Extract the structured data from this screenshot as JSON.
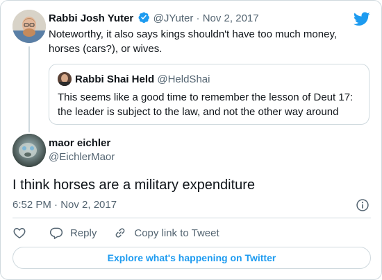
{
  "parent_tweet": {
    "author_name": "Rabbi Josh Yuter",
    "handle": "@JYuter",
    "separator": "·",
    "date": "Nov 2, 2017",
    "text": "Noteworthy, it also says kings shouldn't have too much money, horses (cars?), or wives.",
    "verified": true
  },
  "quoted_tweet": {
    "author_name": "Rabbi Shai Held",
    "handle": "@HeldShai",
    "text": "This seems like a good time to remember the lesson of Deut 17: the leader is subject to the law, and not the other way around"
  },
  "main_tweet": {
    "author_name": "maor eichler",
    "handle": "@EichlerMaor",
    "text": "I think horses are a military expenditure",
    "timestamp": "6:52 PM · Nov 2, 2017"
  },
  "actions": {
    "reply_label": "Reply",
    "copy_link_label": "Copy link to Tweet"
  },
  "explore_label": "Explore what's happening on Twitter",
  "colors": {
    "accent": "#1d9bf0",
    "text": "#0f1419",
    "muted": "#536471",
    "border": "#cfd9de"
  },
  "icons": {
    "brand": "twitter-bird-icon",
    "verified": "verified-badge-icon",
    "info": "info-icon",
    "like": "heart-icon",
    "reply": "speech-bubble-icon",
    "copy_link": "link-icon"
  }
}
